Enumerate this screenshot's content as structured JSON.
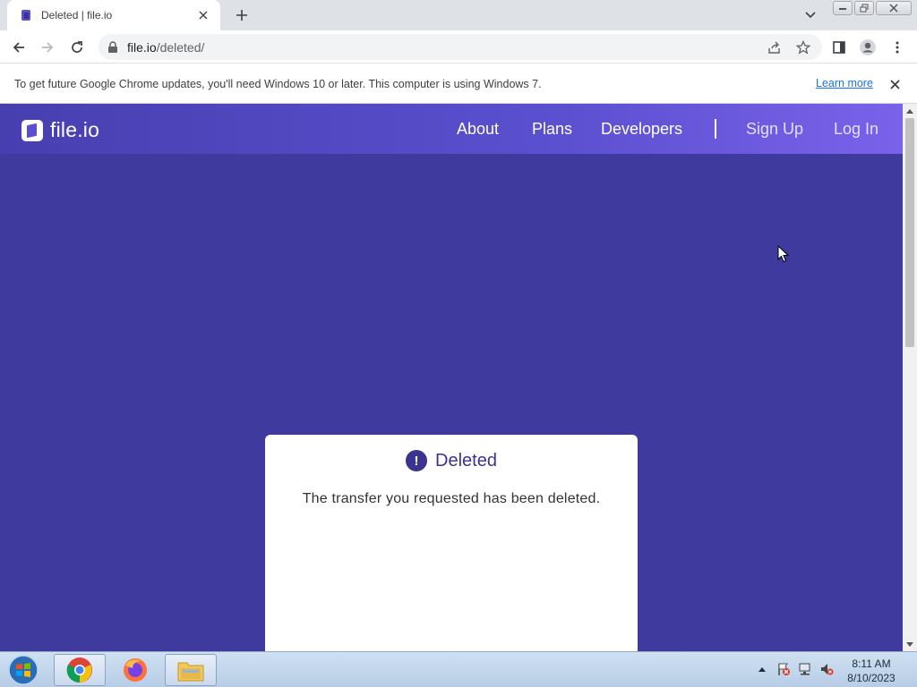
{
  "browser": {
    "tab": {
      "title": "Deleted | file.io"
    },
    "url": {
      "host": "file.io",
      "path": "/deleted/"
    }
  },
  "infobar": {
    "message": "To get future Google Chrome updates, you'll need Windows 10 or later. This computer is using Windows 7.",
    "link_label": "Learn more"
  },
  "site": {
    "logo_text": "file.io",
    "nav": {
      "about": "About",
      "plans": "Plans",
      "developers": "Developers",
      "sign_up": "Sign Up",
      "log_in": "Log In"
    },
    "card": {
      "icon_glyph": "!",
      "title": "Deleted",
      "message": "The transfer you requested has been deleted."
    },
    "colors": {
      "background": "#3f3a9e",
      "header_start": "#473fb0",
      "header_end": "#7a62ea",
      "accent": "#3b338f"
    }
  },
  "taskbar": {
    "apps": [
      "chrome-icon",
      "firefox-icon",
      "file-explorer-icon"
    ],
    "clock": {
      "time": "8:11 AM",
      "date": "8/10/2023"
    }
  }
}
